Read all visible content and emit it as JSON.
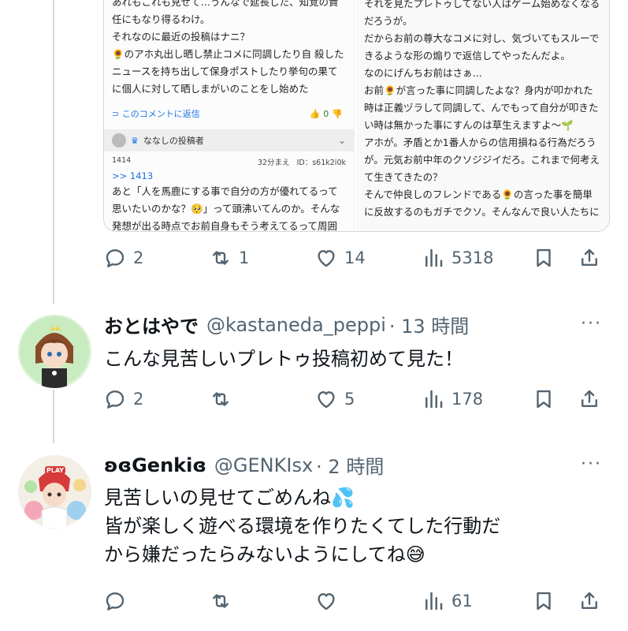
{
  "embed": {
    "left_text_top": "あれもこれも見せて…うんなで延長した、知覚の責任にもなり得るわけ。\nそれなのに最近の投稿はナニ？\n🌻のアホ丸出し晒し禁止コメに同調したり自 殺したニュースを持ち出して保身ポストしたり挙句の果てに個人に対して晒しまがいのことをし始めた",
    "reply_link": "このコメントに返信",
    "like_count": "0",
    "poster_name": "ななしの投稿者",
    "comment_number": "1414",
    "comment_time": "32分まえ",
    "comment_id": "ID：s61k2i0k",
    "ref": ">> 1413",
    "left_text_body": "あと「人を馬鹿にする事で自分の方が優れてるって思いたいのかな？🥺」って頭沸いてんのか。そんな発想が出る時点でお前自身もそう考えてるって周囲に知",
    "right_text": "それを見たプレトゥしてない人はゲーム始めなくなるだろうが。\nだからお前の尊大なコメに対し、気づいてもスルーできるような形の煽りで返信してやったんだよ。\nなのにげんちお前はさぁ…\nお前🌻が言った事に同調したよな？身内が叩かれた時は正義ヅラして同調して、んでもって自分が叩きたい時は無かった事にすんのは草生えますよ〜🌱\nアホが。矛盾とか1番人からの信用損ねる行為だろうが。元気お前中年のクソジジイだろ。これまで何考えて生きてきたの？\nそんで仲良しのフレンドである🌻の言った事を簡単に反故するのもガチでクソ。そんなんで良い人たちに"
  },
  "tweet1_actions": {
    "replies": "2",
    "retweets": "1",
    "likes": "14",
    "views": "5318"
  },
  "tweet2": {
    "name": "おとはやで",
    "handle": "@kastaneda_peppi",
    "time": "· 13 時間",
    "text": "こんな見苦しいプレトゥ投稿初めて見た！",
    "replies": "2",
    "retweets": "",
    "likes": "5",
    "views": "178"
  },
  "tweet3": {
    "name": "ʚɞGenkiɞ",
    "handle": "@GENKIsx",
    "time": "· 2 時間",
    "line1": "見苦しいの見せてごめんね💦",
    "line2": "皆が楽しく遊べる環境を作りたくてした行動だ",
    "line3": "から嫌だったらみないようにしてね😅",
    "replies": "",
    "retweets": "",
    "likes": "",
    "views": "61"
  },
  "more_label": "···",
  "colors": {
    "icon_gray": "#536471",
    "border": "#cfd9de",
    "link_blue": "#1a73e8"
  }
}
